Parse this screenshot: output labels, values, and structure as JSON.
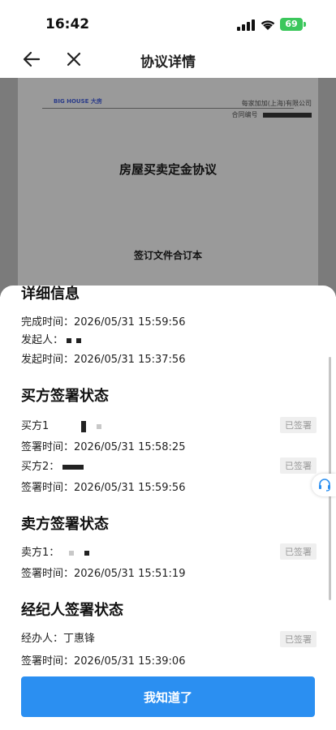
{
  "status_bar": {
    "time": "16:42",
    "battery": "69"
  },
  "nav": {
    "title": "协议详情"
  },
  "document": {
    "logo": "BIG HOUSE 大房",
    "corp": "每家加加(上海)有限公司",
    "contract_no_label": "合同编号",
    "title": "房屋买卖定金协议",
    "subtitle": "签订文件合订本"
  },
  "details": {
    "section_title": "详细信息",
    "completed": {
      "label": "完成时间：",
      "value": "2026/05/31 15:59:56"
    },
    "initiator": {
      "label": "发起人："
    },
    "initiated": {
      "label": "发起时间：",
      "value": "2026/05/31 15:37:56"
    }
  },
  "buyer": {
    "section_title": "买方签署状态",
    "parties": [
      {
        "label": "买方1",
        "status": "已签署",
        "time_label": "签署时间：",
        "time": "2026/05/31 15:58:25"
      },
      {
        "label": "买方2：",
        "status": "已签署",
        "time_label": "签署时间：",
        "time": "2026/05/31 15:59:56"
      }
    ]
  },
  "seller": {
    "section_title": "卖方签署状态",
    "parties": [
      {
        "label": "卖方1：",
        "status": "已签署",
        "time_label": "签署时间：",
        "time": "2026/05/31 15:51:19"
      }
    ]
  },
  "agent": {
    "section_title": "经纪人签署状态",
    "parties": [
      {
        "label": "经办人：丁惠锋",
        "status": "已签署",
        "time_label": "签署时间：",
        "time": "2026/05/31 15:39:06"
      }
    ]
  },
  "button": {
    "confirm": "我知道了"
  }
}
